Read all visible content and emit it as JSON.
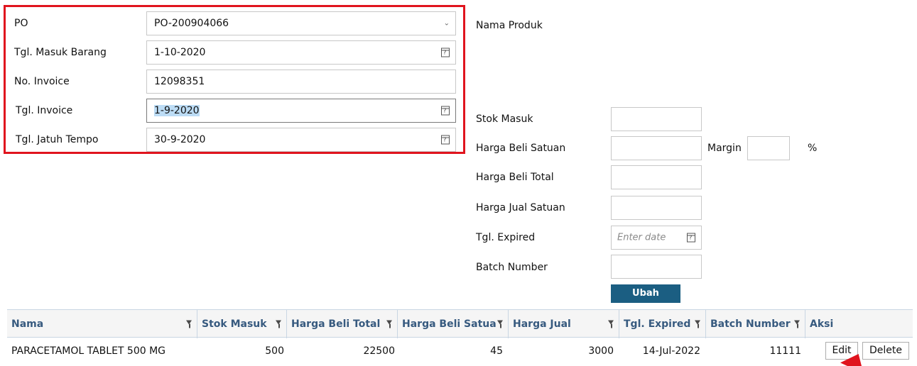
{
  "form": {
    "po": {
      "label": "PO",
      "value": "PO-200904066"
    },
    "tgl_masuk": {
      "label": "Tgl. Masuk Barang",
      "value": "1-10-2020"
    },
    "no_invoice": {
      "label": "No. Invoice",
      "value": "12098351"
    },
    "tgl_invoice": {
      "label": "Tgl. Invoice",
      "value": "1-9-2020"
    },
    "tgl_jatuh_tempo": {
      "label": "Tgl. Jatuh Tempo",
      "value": "30-9-2020"
    }
  },
  "detail": {
    "nama_produk_label": "Nama Produk",
    "stok_masuk_label": "Stok Masuk",
    "harga_beli_satuan_label": "Harga Beli Satuan",
    "margin_label": "Margin",
    "percent_label": "%",
    "harga_beli_total_label": "Harga Beli Total",
    "harga_jual_satuan_label": "Harga Jual Satuan",
    "tgl_expired_label": "Tgl. Expired",
    "tgl_expired_placeholder": "Enter date",
    "batch_number_label": "Batch Number",
    "ubah_label": "Ubah"
  },
  "grid": {
    "columns": [
      "Nama",
      "Stok Masuk",
      "Harga Beli Total",
      "Harga Beli Satua",
      "Harga Jual",
      "Tgl. Expired",
      "Batch Number",
      "Aksi"
    ],
    "rows": [
      {
        "nama": "PARACETAMOL TABLET 500 MG",
        "stok_masuk": "500",
        "harga_beli_total": "22500",
        "harga_beli_satuan": "45",
        "harga_jual": "3000",
        "tgl_expired": "14-Jul-2022",
        "batch_number": "11111",
        "edit_label": "Edit",
        "delete_label": "Delete"
      }
    ]
  },
  "colors": {
    "highlight_border": "#e0141e",
    "header_text": "#375a7f",
    "button_primary": "#1b5e82"
  },
  "icons": {
    "dropdown": "chevron-down-icon",
    "date": "calendar-icon",
    "filter": "filter-icon",
    "annotation": "arrow-icon"
  }
}
